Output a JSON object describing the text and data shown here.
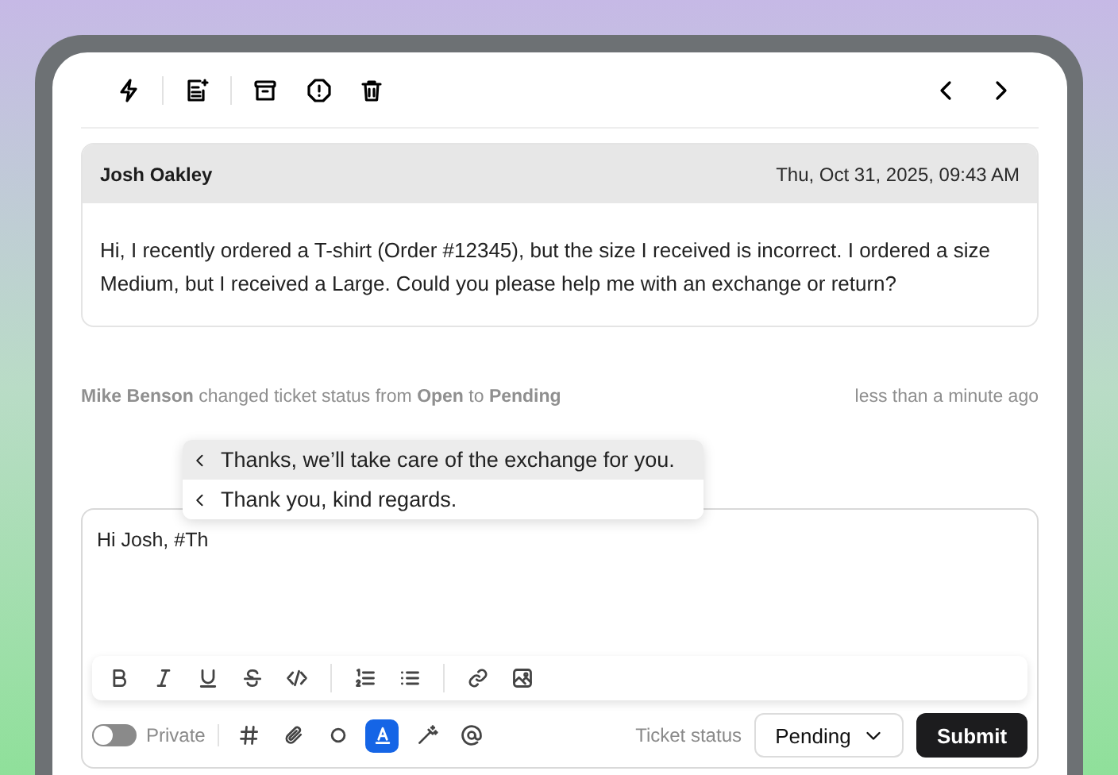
{
  "message": {
    "sender": "Josh Oakley",
    "timestamp": "Thu, Oct 31, 2025, 09:43 AM",
    "body": "Hi, I recently ordered a T-shirt (Order #12345), but the size I received is incorrect. I ordered a size Medium, but I received a Large. Could you please help me with an exchange or return?"
  },
  "activity": {
    "text": "**Mike Benson** changed ticket status from **Open** to **Pending**",
    "time": "less than a minute ago"
  },
  "suggestions": [
    {
      "label": "Thanks, we’ll take care of the exchange for you.",
      "selected": true
    },
    {
      "label": "Thank you, kind regards.",
      "selected": false
    }
  ],
  "editor": {
    "value": "Hi Josh, #Th"
  },
  "private_toggle": {
    "label": "Private",
    "on": false
  },
  "composer_tools": [
    {
      "kind": "hash",
      "selected": false
    },
    {
      "kind": "attach",
      "selected": false
    },
    {
      "kind": "circle",
      "selected": false
    },
    {
      "kind": "text-style",
      "selected": true
    },
    {
      "kind": "magic",
      "selected": false
    },
    {
      "kind": "mention",
      "selected": false
    }
  ],
  "ticket_status": {
    "label": "Ticket status",
    "value": "Pending"
  },
  "submit": "Submit"
}
